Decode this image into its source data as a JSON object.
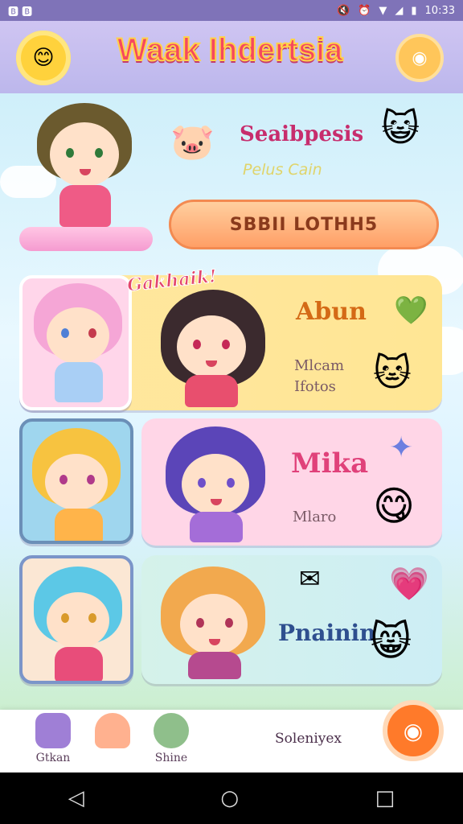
{
  "status_bar": {
    "left_icons": "🅱 🅱",
    "time": "10:33",
    "icons": [
      "mute-icon",
      "alarm-icon",
      "wifi-icon",
      "signal-icon",
      "battery-icon"
    ]
  },
  "header": {
    "title": "Waak Ihdertsia",
    "left_icon": "sun-face-icon",
    "right_icon": "profile-icon"
  },
  "hero": {
    "title": "Seaibpesis",
    "subtitle": "Pelus Cain",
    "button_label": "SBBII LOTHH5"
  },
  "cards": [
    {
      "callout": "Gakhaik!",
      "name": "Abun",
      "sub": [
        "Mlcam",
        "Ifotos"
      ]
    },
    {
      "name": "Mika",
      "sub": [
        "Mlaro"
      ]
    },
    {
      "name": "Pnainin",
      "sub": []
    }
  ],
  "bottom_nav": {
    "items": [
      {
        "label": "Gtkan"
      },
      {
        "label": ""
      },
      {
        "label": "Shine"
      }
    ],
    "status_text": "Soleniyex"
  },
  "colors": {
    "accent": "#f6485f",
    "fab": "#ff7a2a",
    "header": "#bcb7ec"
  }
}
